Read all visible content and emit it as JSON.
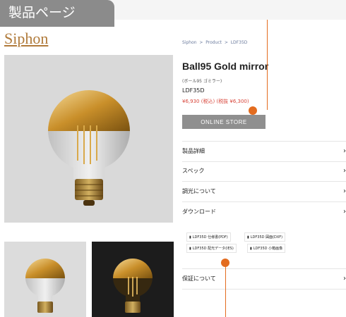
{
  "tab_label": "製品ページ",
  "logo": "Siphon",
  "breadcrumb": [
    "Siphon",
    "Product",
    "LDF35D"
  ],
  "breadcrumb_sep": ">",
  "product": {
    "title": "Ball95 Gold mirror",
    "subtitle": "(ボール95 ゴミラー)",
    "model": "LDF35D",
    "price": "¥6,930 (税込) (税抜 ¥6,300)",
    "button": "ONLINE STORE"
  },
  "accordion": [
    {
      "label": "製品詳細"
    },
    {
      "label": "スペック"
    },
    {
      "label": "調光について"
    },
    {
      "label": "ダウンロード"
    }
  ],
  "downloads": [
    "LDF35D 仕様書(PDF)",
    "LDF35D 図面(DXF)",
    "LDF35D 配光データ(IES)",
    "LDF35D 小箱画像"
  ],
  "warranty": "保証について",
  "arrow": "›",
  "colors": {
    "accent": "#e36c1f",
    "price": "#d8453a",
    "button": "#8f8f8f",
    "gold": "#c99a3a"
  }
}
